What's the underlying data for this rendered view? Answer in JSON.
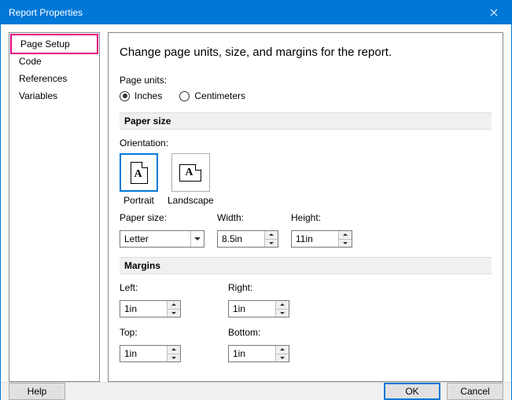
{
  "window": {
    "title": "Report Properties"
  },
  "sidebar": {
    "items": [
      {
        "label": "Page Setup",
        "active": true
      },
      {
        "label": "Code"
      },
      {
        "label": "References"
      },
      {
        "label": "Variables"
      }
    ]
  },
  "main": {
    "title": "Change page units, size, and margins for the report.",
    "page_units": {
      "label": "Page units:",
      "options": {
        "inches": "Inches",
        "centimeters": "Centimeters"
      },
      "selected": "inches"
    },
    "paper_size": {
      "header": "Paper size",
      "orientation": {
        "label": "Orientation:",
        "portrait": "Portrait",
        "landscape": "Landscape",
        "selected": "portrait"
      },
      "size_label": "Paper size:",
      "size_value": "Letter",
      "width_label": "Width:",
      "width_value": "8.5in",
      "height_label": "Height:",
      "height_value": "11in"
    },
    "margins": {
      "header": "Margins",
      "left_label": "Left:",
      "left_value": "1in",
      "right_label": "Right:",
      "right_value": "1in",
      "top_label": "Top:",
      "top_value": "1in",
      "bottom_label": "Bottom:",
      "bottom_value": "1in"
    }
  },
  "footer": {
    "help": "Help",
    "ok": "OK",
    "cancel": "Cancel"
  }
}
